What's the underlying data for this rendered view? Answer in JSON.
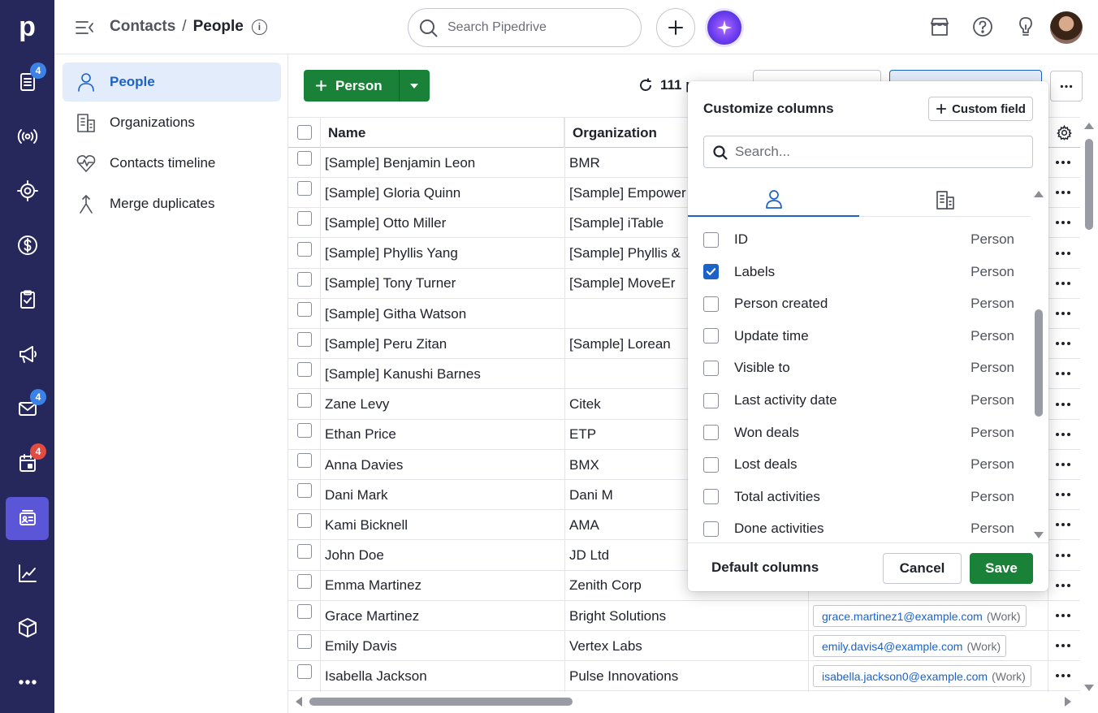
{
  "rail": {
    "logo": "p",
    "items": [
      {
        "icon": "leads-inbox-icon",
        "badge": "4",
        "badge_color": "#3a82e8"
      },
      {
        "icon": "broadcast-icon",
        "badge": ""
      },
      {
        "icon": "target-icon",
        "badge": ""
      },
      {
        "icon": "deals-dollar-icon",
        "badge": ""
      },
      {
        "icon": "activities-clipboard-icon",
        "badge": ""
      },
      {
        "icon": "campaigns-megaphone-icon",
        "badge": ""
      },
      {
        "icon": "mail-icon",
        "badge": "4",
        "badge_color": "#3a82e8"
      },
      {
        "icon": "calendar-icon",
        "badge": "4",
        "badge_color": "#e14b41"
      },
      {
        "icon": "contacts-card-icon",
        "badge": "",
        "active": true
      },
      {
        "icon": "insights-chart-icon",
        "badge": ""
      },
      {
        "icon": "products-box-icon",
        "badge": ""
      },
      {
        "icon": "more-dots-icon",
        "badge": ""
      }
    ]
  },
  "topbar": {
    "breadcrumb_parent": "Contacts",
    "breadcrumb_separator": "/",
    "breadcrumb_current": "People",
    "search_placeholder": "Search Pipedrive"
  },
  "sidenav": {
    "items": [
      {
        "label": "People",
        "icon": "person-icon",
        "active": true
      },
      {
        "label": "Organizations",
        "icon": "building-icon"
      },
      {
        "label": "Contacts timeline",
        "icon": "heart-pulse-icon"
      },
      {
        "label": "Merge duplicates",
        "icon": "merge-icon"
      }
    ]
  },
  "toolbar": {
    "add_person_label": "Person",
    "count_text": "111 p"
  },
  "table": {
    "columns": [
      "Name",
      "Organization"
    ],
    "rows": [
      {
        "name": "[Sample] Benjamin Leon",
        "org": "BMR",
        "email": "",
        "tag": ""
      },
      {
        "name": "[Sample] Gloria Quinn",
        "org": "[Sample] Empower",
        "email": "",
        "tag": ""
      },
      {
        "name": "[Sample] Otto Miller",
        "org": "[Sample] iTable",
        "email": "",
        "tag": ""
      },
      {
        "name": "[Sample] Phyllis Yang",
        "org": "[Sample] Phyllis &",
        "email": "",
        "tag": ""
      },
      {
        "name": "[Sample] Tony Turner",
        "org": "[Sample] MoveEr",
        "email": "",
        "tag": ""
      },
      {
        "name": "[Sample] Githa Watson",
        "org": "",
        "email": "",
        "tag": ""
      },
      {
        "name": "[Sample] Peru Zitan",
        "org": "[Sample] Lorean",
        "email": "",
        "tag": ""
      },
      {
        "name": "[Sample] Kanushi Barnes",
        "org": "",
        "email": "",
        "tag": ""
      },
      {
        "name": "Zane Levy",
        "org": "Citek",
        "email": "",
        "tag": ""
      },
      {
        "name": "Ethan Price",
        "org": "ETP",
        "email": "",
        "tag": ""
      },
      {
        "name": "Anna Davies",
        "org": "BMX",
        "email": "",
        "tag": ""
      },
      {
        "name": "Dani Mark",
        "org": "Dani M",
        "email": "",
        "tag": ""
      },
      {
        "name": "Kami Bicknell",
        "org": "AMA",
        "email": "",
        "tag": ""
      },
      {
        "name": "John Doe",
        "org": "JD Ltd",
        "email": "",
        "tag": ""
      },
      {
        "name": "Emma Martinez",
        "org": "Zenith Corp",
        "email": "",
        "tag": ""
      },
      {
        "name": "Grace Martinez",
        "org": "Bright Solutions",
        "email": "grace.martinez1@example.com",
        "tag": "(Work)"
      },
      {
        "name": "Emily Davis",
        "org": "Vertex Labs",
        "email": "emily.davis4@example.com",
        "tag": "(Work)"
      },
      {
        "name": "Isabella Jackson",
        "org": "Pulse Innovations",
        "email": "isabella.jackson0@example.com",
        "tag": "(Work)"
      }
    ]
  },
  "customize": {
    "title": "Customize columns",
    "custom_field_label": "Custom field",
    "search_placeholder": "Search...",
    "fields": [
      {
        "name": "ID",
        "type": "Person",
        "checked": false
      },
      {
        "name": "Labels",
        "type": "Person",
        "checked": true
      },
      {
        "name": "Person created",
        "type": "Person",
        "checked": false
      },
      {
        "name": "Update time",
        "type": "Person",
        "checked": false
      },
      {
        "name": "Visible to",
        "type": "Person",
        "checked": false
      },
      {
        "name": "Last activity date",
        "type": "Person",
        "checked": false
      },
      {
        "name": "Won deals",
        "type": "Person",
        "checked": false
      },
      {
        "name": "Lost deals",
        "type": "Person",
        "checked": false
      },
      {
        "name": "Total activities",
        "type": "Person",
        "checked": false
      },
      {
        "name": "Done activities",
        "type": "Person",
        "checked": false
      }
    ],
    "default_columns_label": "Default columns",
    "cancel_label": "Cancel",
    "save_label": "Save"
  },
  "colors": {
    "rail_bg": "#26275a",
    "rail_active": "#5b55d8",
    "primary_green": "#1a8139",
    "link_blue": "#1b62c9",
    "nav_active_bg": "#e3ecfb"
  }
}
